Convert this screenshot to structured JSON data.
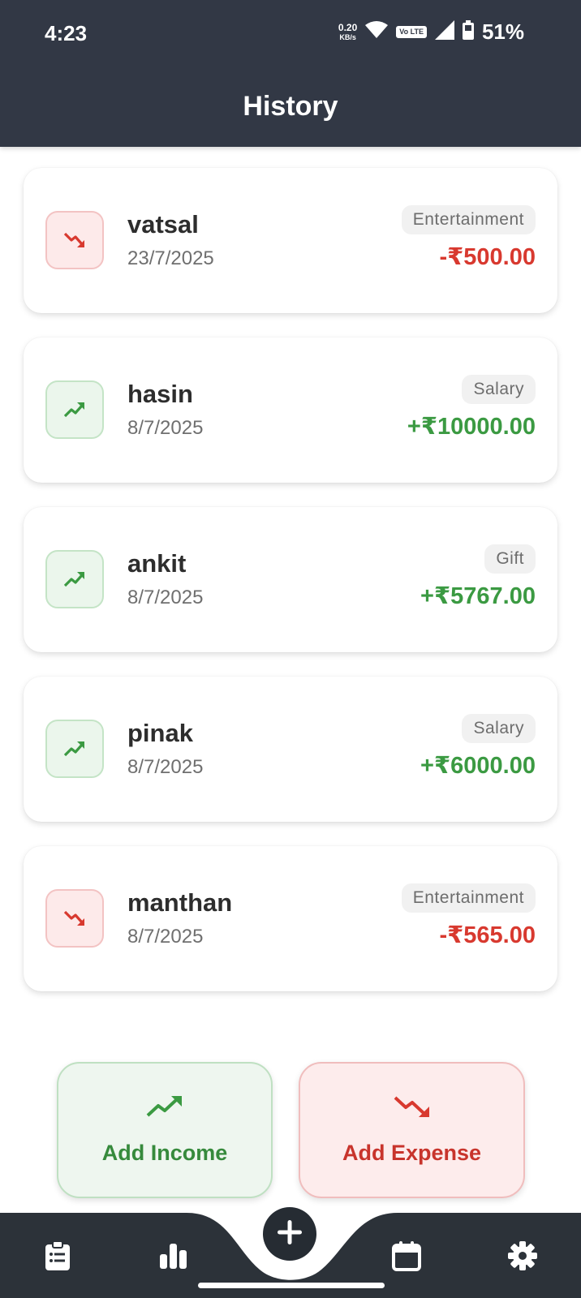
{
  "status_bar": {
    "time": "4:23",
    "net_speed_value": "0.20",
    "net_speed_unit": "KB/s",
    "volte_label": "Vo LTE",
    "battery": "51%"
  },
  "header": {
    "title": "History"
  },
  "transactions": [
    {
      "name": "vatsal",
      "date": "23/7/2025",
      "category": "Entertainment",
      "amount": "-₹500.00",
      "type": "expense"
    },
    {
      "name": "hasin",
      "date": "8/7/2025",
      "category": "Salary",
      "amount": "+₹10000.00",
      "type": "income"
    },
    {
      "name": "ankit",
      "date": "8/7/2025",
      "category": "Gift",
      "amount": "+₹5767.00",
      "type": "income"
    },
    {
      "name": "pinak",
      "date": "8/7/2025",
      "category": "Salary",
      "amount": "+₹6000.00",
      "type": "income"
    },
    {
      "name": "manthan",
      "date": "8/7/2025",
      "category": "Entertainment",
      "amount": "-₹565.00",
      "type": "expense"
    }
  ],
  "actions": {
    "add_income_label": "Add Income",
    "add_expense_label": "Add Expense"
  },
  "bottom_nav": {
    "items": [
      {
        "icon": "clipboard-list-icon"
      },
      {
        "icon": "bar-chart-icon"
      },
      {
        "icon": "plus-icon"
      },
      {
        "icon": "calendar-icon"
      },
      {
        "icon": "gear-icon"
      }
    ]
  },
  "colors": {
    "header_bg": "#323845",
    "income": "#3b9a42",
    "expense": "#d8392f",
    "nav_bg": "#2c3239"
  }
}
